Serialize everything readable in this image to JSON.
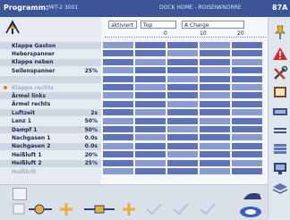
{
  "header": {
    "program_label": "Programm:",
    "program_name": "MIT-2 3001",
    "section_title": "DOCK HOME - ROISENKNORRE",
    "code": "87A"
  },
  "controls": {
    "mode": "aktiviert",
    "dropdown_left": "Top",
    "dropdown_right": "A Charge"
  },
  "scale": {
    "ticks": [
      "0",
      "10",
      "20"
    ]
  },
  "params": [
    {
      "label": "Klappe Gaston",
      "value": "",
      "style": "alt",
      "dot": false
    },
    {
      "label": "Heberspanner",
      "value": "",
      "style": "",
      "dot": false
    },
    {
      "label": "Klappe neben",
      "value": "",
      "style": "alt",
      "dot": false
    },
    {
      "label": "Seilenspanner",
      "value": "25%",
      "style": "",
      "dot": false
    },
    {
      "label": "",
      "value": "",
      "style": "alt",
      "dot": false
    },
    {
      "label": "Klappe rechts",
      "value": "",
      "style": "dis",
      "dot": true
    },
    {
      "label": "Ärmel links",
      "value": "",
      "style": "alt",
      "dot": false
    },
    {
      "label": "Ärmel rechts",
      "value": "",
      "style": "",
      "dot": false
    },
    {
      "label": "Luftzeit",
      "value": "2s",
      "style": "alt",
      "dot": false
    },
    {
      "label": "Lenz 1",
      "value": "50%",
      "style": "",
      "dot": false
    },
    {
      "label": "Dampf 1",
      "value": "50%",
      "style": "alt",
      "dot": false
    },
    {
      "label": "Nachgasen 1",
      "value": "0.0s",
      "style": "",
      "dot": false
    },
    {
      "label": "Nachgasen 2",
      "value": "0.0s",
      "style": "alt",
      "dot": false
    },
    {
      "label": "Heißluft 1",
      "value": "20%",
      "style": "",
      "dot": false
    },
    {
      "label": "Heißluft 2",
      "value": "25%",
      "style": "alt",
      "dot": false
    },
    {
      "label": "Heißluft",
      "value": "",
      "style": "dis",
      "dot": false
    }
  ],
  "icons": {
    "logo": "program-logo-icon",
    "right": [
      "thumbtack-icon",
      "warning-icon",
      "tools-icon",
      "book-icon",
      "sheet-icon",
      "equals-icon",
      "stack-icon",
      "monitor-icon",
      "layers-icon"
    ],
    "bottom": [
      "small-box-icon",
      "clamp-minus-icon",
      "clamp-plus-icon",
      "clamp-minus-2-icon",
      "clamp-plus-2-icon",
      "check-one-icon",
      "check-two-icon",
      "check-three-icon",
      "hand-icon"
    ]
  },
  "colors": {
    "header": "#3c5598",
    "grid_cell": "#5e73b8",
    "warning": "#d62828"
  }
}
